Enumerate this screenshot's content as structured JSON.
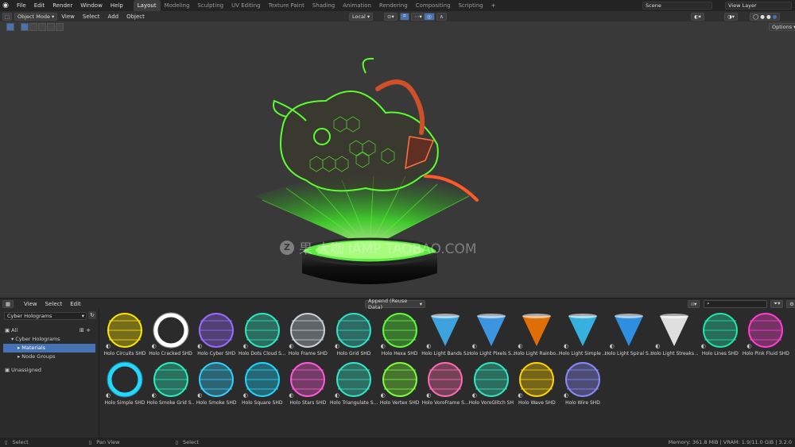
{
  "topbar": {
    "menus": [
      "File",
      "Edit",
      "Render",
      "Window",
      "Help"
    ],
    "workspaces": [
      "Layout",
      "Modeling",
      "Sculpting",
      "UV Editing",
      "Texture Paint",
      "Shading",
      "Animation",
      "Rendering",
      "Compositing",
      "Scripting"
    ],
    "active_workspace": "Layout",
    "plus": "+",
    "scene": "Scene",
    "view_layer": "View Layer"
  },
  "viewport_header": {
    "mode": "Object Mode",
    "menus": [
      "View",
      "Select",
      "Add",
      "Object"
    ],
    "transform": "Local",
    "options": "Options"
  },
  "watermark": {
    "text": "果  大咖  IAMP  TAOBAO.COM"
  },
  "asset_browser": {
    "menus": [
      "View",
      "Select",
      "Edit"
    ],
    "import_mode": "Append (Reuse Data)",
    "library": "Cyber Holograms",
    "tree": [
      {
        "label": "All",
        "level": 0
      },
      {
        "label": "Cyber Holograms",
        "level": 1
      },
      {
        "label": "Materials",
        "level": 2,
        "selected": true
      },
      {
        "label": "Node Groups",
        "level": 2
      },
      {
        "label": "Unassigned",
        "level": 0
      }
    ],
    "assets": [
      {
        "name": "Holo Circuits SHD",
        "color": "#ffe500",
        "kind": "sphere"
      },
      {
        "name": "Holo Cracked SHD",
        "color": "#ffffff",
        "kind": "ring"
      },
      {
        "name": "Holo Cyber SHD",
        "color": "#9a6bff",
        "kind": "sphere"
      },
      {
        "name": "Holo Dots Cloud S...",
        "color": "#2ee8c0",
        "kind": "sphere"
      },
      {
        "name": "Holo Frame SHD",
        "color": "#c8d0d8",
        "kind": "sphere"
      },
      {
        "name": "Holo Grid SHD",
        "color": "#30e0c8",
        "kind": "sphere"
      },
      {
        "name": "Holo Hexa SHD",
        "color": "#5dff3a",
        "kind": "sphere"
      },
      {
        "name": "Holo Light Bands S...",
        "color": "#3fb8ff",
        "kind": "cone"
      },
      {
        "name": "Holo Light Pixels S...",
        "color": "#3fa8ff",
        "kind": "cone"
      },
      {
        "name": "Holo Light Rainbo...",
        "color": "#ff7a00",
        "kind": "cone"
      },
      {
        "name": "Holo Light Simple ...",
        "color": "#38c8ff",
        "kind": "cone"
      },
      {
        "name": "Holo Light Spiral S...",
        "color": "#2fa0ff",
        "kind": "cone"
      },
      {
        "name": "Holo Light Streaks ...",
        "color": "#ffffff",
        "kind": "cone"
      },
      {
        "name": "Holo Lines SHD",
        "color": "#1fe8a8",
        "kind": "sphere"
      },
      {
        "name": "Holo Pink Fluid SHD",
        "color": "#ff3fd0",
        "kind": "sphere"
      },
      {
        "name": "Holo Simple SHD",
        "color": "#23d8ff",
        "kind": "ring"
      },
      {
        "name": "Holo Smoke Grid S...",
        "color": "#28f0c0",
        "kind": "sphere"
      },
      {
        "name": "Holo Smoke SHD",
        "color": "#30d0ff",
        "kind": "sphere"
      },
      {
        "name": "Holo Square SHD",
        "color": "#1ed8ff",
        "kind": "sphere"
      },
      {
        "name": "Holo Stars SHD",
        "color": "#ff5ad8",
        "kind": "sphere"
      },
      {
        "name": "Holo Triangulate S...",
        "color": "#30e8c8",
        "kind": "sphere"
      },
      {
        "name": "Holo Vertex SHD",
        "color": "#7aff3a",
        "kind": "sphere"
      },
      {
        "name": "Holo VoroFrame S...",
        "color": "#ff6bb0",
        "kind": "sphere"
      },
      {
        "name": "Holo VoroGlitch SH",
        "color": "#30e8c0",
        "kind": "sphere"
      },
      {
        "name": "Holo Wave SHD",
        "color": "#ffd400",
        "kind": "sphere"
      },
      {
        "name": "Holo Wire SHD",
        "color": "#8a8aff",
        "kind": "sphere"
      }
    ]
  },
  "statusbar": {
    "left1": "Select",
    "left2": "Pan View",
    "left3": "Select",
    "right": "Memory: 361.8 MiB | VRAM: 1.9/11.0 GiB | 3.2.0"
  }
}
